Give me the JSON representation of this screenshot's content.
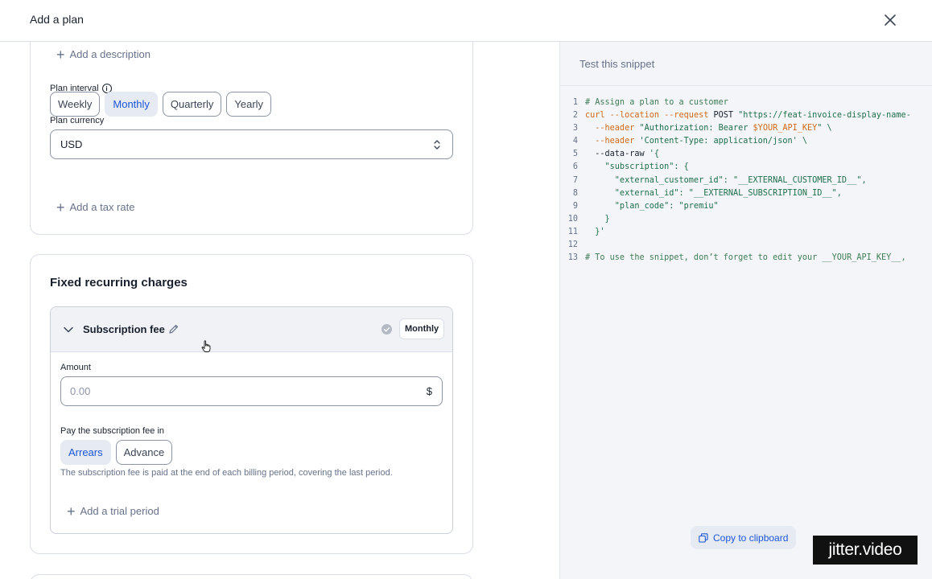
{
  "header": {
    "title": "Add a plan",
    "close_icon": "close-icon"
  },
  "settings": {
    "add_description": "Add a description",
    "interval_label": "Plan interval",
    "intervals": [
      {
        "label": "Weekly",
        "active": false
      },
      {
        "label": "Monthly",
        "active": true
      },
      {
        "label": "Quarterly",
        "active": false
      },
      {
        "label": "Yearly",
        "active": false
      }
    ],
    "currency_label": "Plan currency",
    "currency_value": "USD",
    "add_tax_rate": "Add a tax rate"
  },
  "charges": {
    "title": "Fixed recurring charges",
    "fee": {
      "name": "Subscription fee",
      "interval_badge": "Monthly",
      "amount_label": "Amount",
      "amount_placeholder": "0.00",
      "currency_symbol": "$",
      "pay_label": "Pay the subscription fee in",
      "pay_options": [
        {
          "label": "Arrears",
          "active": true
        },
        {
          "label": "Advance",
          "active": false
        }
      ],
      "pay_help": "The subscription fee is paid at the end of each billing period, covering the last period.",
      "add_trial": "Add a trial period"
    }
  },
  "snippet": {
    "title": "Test this snippet",
    "lines": [
      [
        {
          "t": "# Assign a plan to a customer",
          "c": "com"
        }
      ],
      [
        {
          "t": "curl ",
          "c": "kw"
        },
        {
          "t": "--location ",
          "c": "kw"
        },
        {
          "t": "--request ",
          "c": "kw"
        },
        {
          "t": "POST ",
          "c": ""
        },
        {
          "t": "\"https://feat-invoice-display-name-",
          "c": "str"
        }
      ],
      [
        {
          "t": "  --header ",
          "c": "kw"
        },
        {
          "t": "\"Authorization: Bearer ",
          "c": "str"
        },
        {
          "t": "$YOUR_API_KEY",
          "c": "var"
        },
        {
          "t": "\" \\",
          "c": "str"
        }
      ],
      [
        {
          "t": "  --header ",
          "c": "kw"
        },
        {
          "t": "'Content-Type: application/json' \\",
          "c": "str"
        }
      ],
      [
        {
          "t": "  --data-raw ",
          "c": ""
        },
        {
          "t": "'{",
          "c": "str"
        }
      ],
      [
        {
          "t": "    \"subscription\": {",
          "c": "str"
        }
      ],
      [
        {
          "t": "      \"external_customer_id\": \"__EXTERNAL_CUSTOMER_ID__\",",
          "c": "str"
        }
      ],
      [
        {
          "t": "      \"external_id\": \"__EXTERNAL_SUBSCRIPTION_ID__\",",
          "c": "str"
        }
      ],
      [
        {
          "t": "      \"plan_code\": \"premiu\"",
          "c": "str"
        }
      ],
      [
        {
          "t": "    }",
          "c": "str"
        }
      ],
      [
        {
          "t": "  }'",
          "c": "str"
        }
      ],
      [
        {
          "t": "",
          "c": ""
        }
      ],
      [
        {
          "t": "# To use the snippet, don’t forget to edit your __YOUR_API_KEY__,",
          "c": "com"
        }
      ]
    ],
    "copy_label": "Copy to clipboard"
  },
  "watermark": "jitter.video",
  "colors": {
    "accent": "#1a56d6",
    "active_bg": "#e6eaf2",
    "panel_bg": "#f4f5f8"
  }
}
